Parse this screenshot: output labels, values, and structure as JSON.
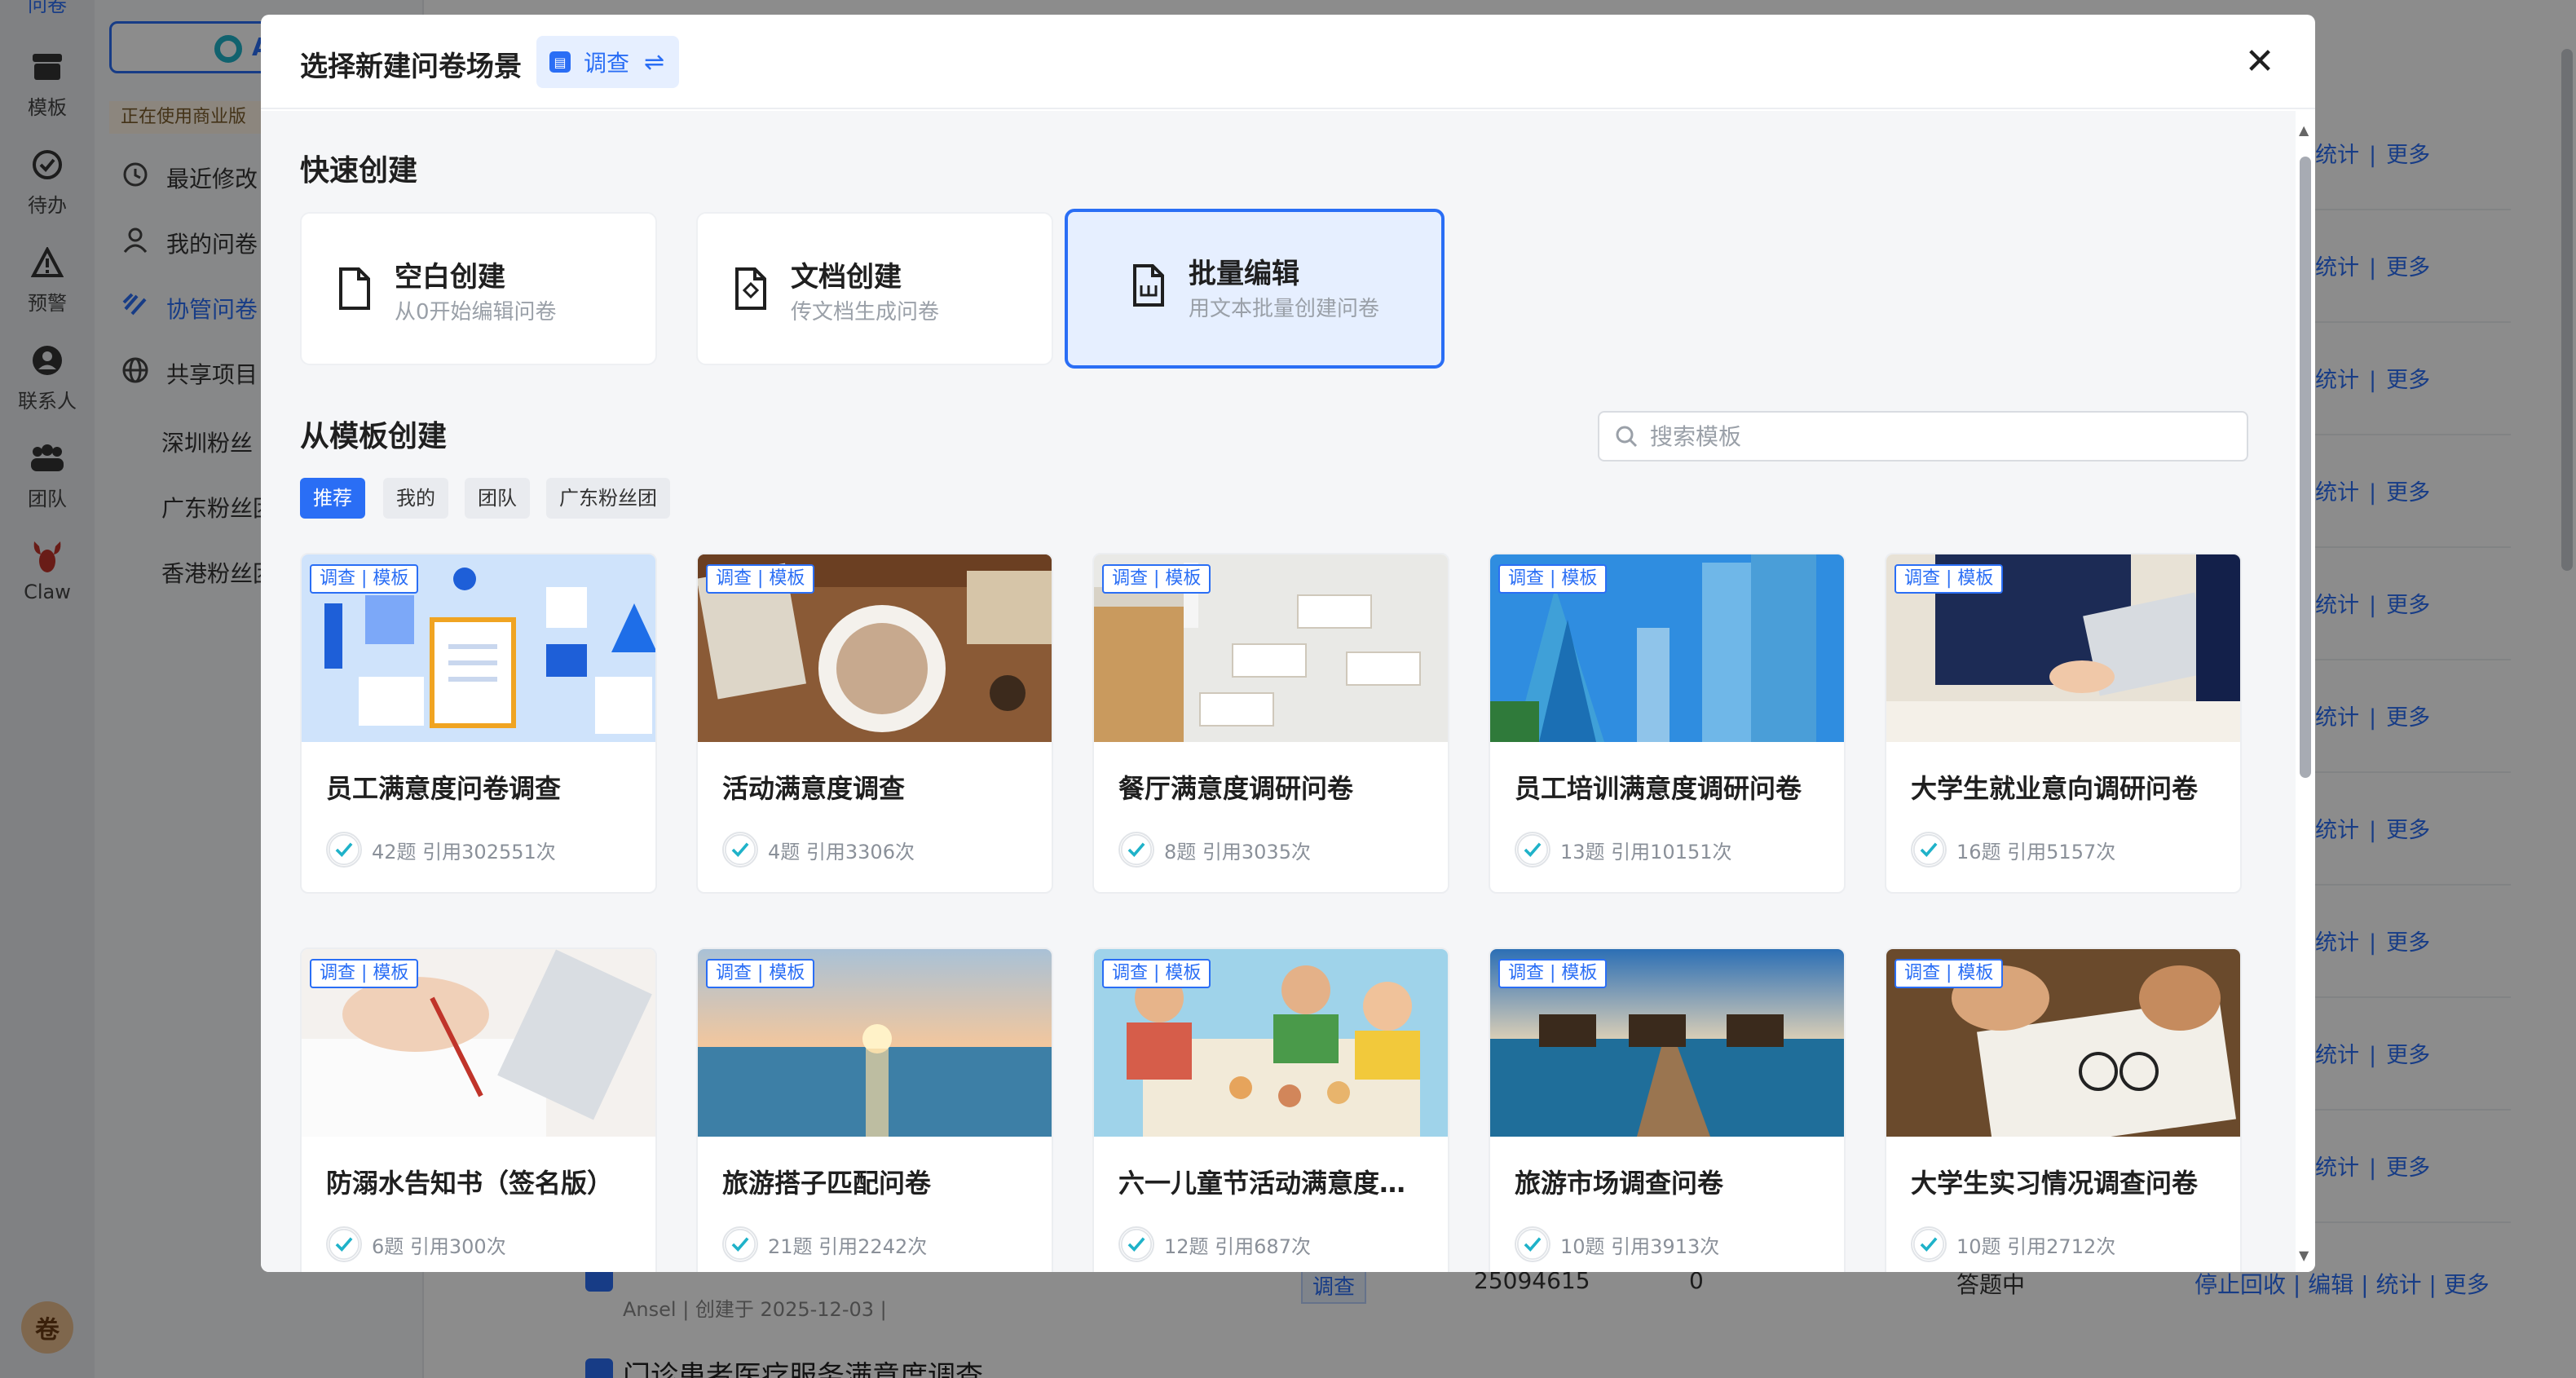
{
  "app": {
    "iconbar": [
      {
        "label": "问卷",
        "icon": "survey-icon"
      },
      {
        "label": "模板",
        "icon": "template-icon"
      },
      {
        "label": "待办",
        "icon": "todo-icon"
      },
      {
        "label": "预警",
        "icon": "warning-icon"
      },
      {
        "label": "联系人",
        "icon": "contact-icon"
      },
      {
        "label": "团队",
        "icon": "team-icon"
      },
      {
        "label": "Claw",
        "icon": "claw-icon"
      }
    ],
    "avatar_text": "卷",
    "ai_button_label": "A",
    "business_notice": "正在使用商业版",
    "nav": [
      {
        "label": "最近修改",
        "icon": "history-icon"
      },
      {
        "label": "我的问卷",
        "icon": "user-icon"
      },
      {
        "label": "协管问卷",
        "icon": "link-icon"
      },
      {
        "label": "共享项目",
        "icon": "globe-icon"
      }
    ],
    "sub_nav": [
      "深圳粉丝",
      "广东粉丝团",
      "香港粉丝团"
    ],
    "row_actions": {
      "stats": "统计",
      "more": "更多",
      "separator": "|"
    },
    "last_row": {
      "meta": "Ansel | 创建于 2025-12-03 |",
      "tag": "调查",
      "count": "25094615",
      "zero": "0",
      "status": "答题中",
      "actions": "停止回收 | 编辑 | 统计 | 更多",
      "next_title": "门诊患者医疗服务满意度调查"
    }
  },
  "modal": {
    "title": "选择新建问卷场景",
    "scene_label": "调查",
    "close_icon": "close-icon",
    "quick_section_title": "快速创建",
    "quick_cards": [
      {
        "name": "空白创建",
        "desc": "从0开始编辑问卷",
        "icon": "blank-file-icon",
        "selected": false
      },
      {
        "name": "文档创建",
        "desc": "传文档生成问卷",
        "icon": "doc-import-icon",
        "selected": false
      },
      {
        "name": "批量编辑",
        "desc": "用文本批量创建问卷",
        "icon": "batch-edit-icon",
        "selected": true
      }
    ],
    "template_section_title": "从模板创建",
    "search_placeholder": "搜索模板",
    "filter_tabs": [
      {
        "label": "推荐",
        "active": true
      },
      {
        "label": "我的",
        "active": false
      },
      {
        "label": "团队",
        "active": false
      },
      {
        "label": "广东粉丝团",
        "active": false
      }
    ],
    "templates": [
      {
        "badge": "调查 | 模板",
        "name": "员工满意度问卷调查",
        "stats": "42题 引用302551次",
        "image": "office-illustration"
      },
      {
        "badge": "调查 | 模板",
        "name": "活动满意度调查",
        "stats": "4题 引用3306次",
        "image": "coffee-table"
      },
      {
        "badge": "调查 | 模板",
        "name": "餐厅满意度调研问卷",
        "stats": "8题 引用3035次",
        "image": "restaurant"
      },
      {
        "badge": "调查 | 模板",
        "name": "员工培训满意度调研问卷",
        "stats": "13题 引用10151次",
        "image": "skyscrapers"
      },
      {
        "badge": "调查 | 模板",
        "name": "大学生就业意向调研问卷",
        "stats": "16题 引用5157次",
        "image": "tablet-reading"
      },
      {
        "badge": "调查 | 模板",
        "name": "防溺水告知书（签名版）",
        "stats": "6题 引用300次",
        "image": "signing"
      },
      {
        "badge": "调查 | 模板",
        "name": "旅游搭子匹配问卷",
        "stats": "21题 引用2242次",
        "image": "sea-sunset"
      },
      {
        "badge": "调查 | 模板",
        "name": "六一儿童节活动满意度…",
        "stats": "12题 引用687次",
        "image": "kids-playing"
      },
      {
        "badge": "调查 | 模板",
        "name": "旅游市场调查问卷",
        "stats": "10题 引用3913次",
        "image": "pier-villas"
      },
      {
        "badge": "调查 | 模板",
        "name": "大学生实习情况调查问卷",
        "stats": "10题 引用2712次",
        "image": "business-meeting"
      }
    ]
  },
  "colors": {
    "accent": "#2a6ef5",
    "overlay": "rgba(0,0,0,0.45)",
    "selected_bg": "#e6efff"
  }
}
